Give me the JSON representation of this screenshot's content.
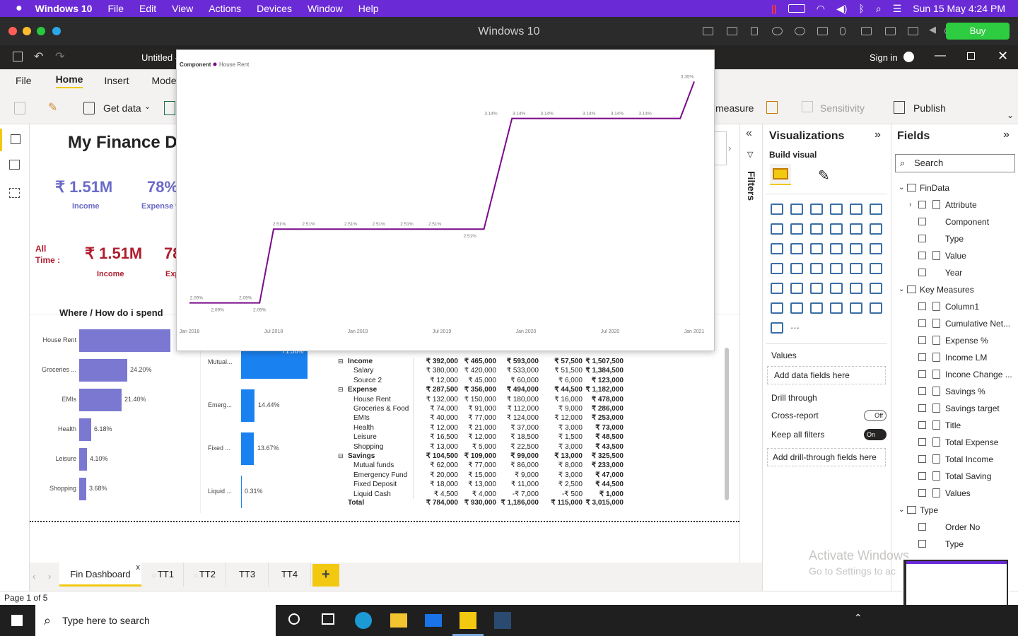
{
  "mac_menu": {
    "app": "Windows 10",
    "items": [
      "File",
      "Edit",
      "View",
      "Actions",
      "Devices",
      "Window",
      "Help"
    ],
    "clock": "Sun 15 May  4:24 PM"
  },
  "vm": {
    "title": "Windows 10",
    "buy": "Buy"
  },
  "pbi": {
    "doc_title": "Untitled -",
    "signin": "Sign in"
  },
  "ribbon": {
    "tabs": [
      "File",
      "Home",
      "Insert",
      "Mode"
    ],
    "get_data": "Get data",
    "measure": "measure",
    "sensitivity": "Sensitivity",
    "publish": "Publish"
  },
  "report": {
    "title": "My Finance D",
    "kpi1_value": "₹ 1.51M",
    "kpi1_label": "Income",
    "kpi2_value": "78%",
    "kpi2_label": "Expense %",
    "all_time": "All\nTime :",
    "kpi3_value": "₹ 1.51M",
    "kpi3_label": "Income",
    "kpi4_value": "78",
    "kpi4_label": "Exp",
    "spend_title": "Where / How do i spend"
  },
  "spend_bars": [
    {
      "label": "House Rent",
      "value": "",
      "pct": 0.46
    },
    {
      "label": "Groceries ...",
      "value": "24.20%",
      "pct": 0.242
    },
    {
      "label": "EMIs",
      "value": "21.40%",
      "pct": 0.214
    },
    {
      "label": "Health",
      "value": "6.18%",
      "pct": 0.0618
    },
    {
      "label": "Leisure",
      "value": "4.10%",
      "pct": 0.041
    },
    {
      "label": "Shopping",
      "value": "3.68%",
      "pct": 0.0368
    }
  ],
  "savings_bars": [
    {
      "label": "Mutual...",
      "value": "71.58%",
      "pct": 0.7158
    },
    {
      "label": "Emerg...",
      "value": "14.44%",
      "pct": 0.1444
    },
    {
      "label": "Fixed ...",
      "value": "13.67%",
      "pct": 0.1367
    },
    {
      "label": "Liquid ...",
      "value": "0.31%",
      "pct": 0.0031
    }
  ],
  "matrix": [
    [
      "Income",
      "₹ 392,000",
      "₹ 465,000",
      "₹ 593,000",
      "₹ 57,500",
      "₹ 1,507,500"
    ],
    [
      "Salary",
      "₹ 380,000",
      "₹ 420,000",
      "₹ 533,000",
      "₹ 51,500",
      "₹ 1,384,500"
    ],
    [
      "Source 2",
      "₹ 12,000",
      "₹ 45,000",
      "₹ 60,000",
      "₹ 6,000",
      "₹ 123,000"
    ],
    [
      "Expense",
      "₹ 287,500",
      "₹ 356,000",
      "₹ 494,000",
      "₹ 44,500",
      "₹ 1,182,000"
    ],
    [
      "House Rent",
      "₹ 132,000",
      "₹ 150,000",
      "₹ 180,000",
      "₹ 16,000",
      "₹ 478,000"
    ],
    [
      "Groceries & Food",
      "₹ 74,000",
      "₹ 91,000",
      "₹ 112,000",
      "₹ 9,000",
      "₹ 286,000"
    ],
    [
      "EMIs",
      "₹ 40,000",
      "₹ 77,000",
      "₹ 124,000",
      "₹ 12,000",
      "₹ 253,000"
    ],
    [
      "Health",
      "₹ 12,000",
      "₹ 21,000",
      "₹ 37,000",
      "₹ 3,000",
      "₹ 73,000"
    ],
    [
      "Leisure",
      "₹ 16,500",
      "₹ 12,000",
      "₹ 18,500",
      "₹ 1,500",
      "₹ 48,500"
    ],
    [
      "Shopping",
      "₹ 13,000",
      "₹ 5,000",
      "₹ 22,500",
      "₹ 3,000",
      "₹ 43,500"
    ],
    [
      "Savings",
      "₹ 104,500",
      "₹ 109,000",
      "₹ 99,000",
      "₹ 13,000",
      "₹ 325,500"
    ],
    [
      "Mutual funds",
      "₹ 62,000",
      "₹ 77,000",
      "₹ 86,000",
      "₹ 8,000",
      "₹ 233,000"
    ],
    [
      "Emergency Fund",
      "₹ 20,000",
      "₹ 15,000",
      "₹ 9,000",
      "₹ 3,000",
      "₹ 47,000"
    ],
    [
      "Fixed Deposit",
      "₹ 18,000",
      "₹ 13,000",
      "₹ 11,000",
      "₹ 2,500",
      "₹ 44,500"
    ],
    [
      "Liquid Cash",
      "₹ 4,500",
      "₹ 4,000",
      "-₹ 7,000",
      "-₹ 500",
      "₹ 1,000"
    ]
  ],
  "matrix_total": [
    "Total",
    "₹ 784,000",
    "₹ 930,000",
    "₹ 1,186,000",
    "₹ 115,000",
    "₹ 3,015,000"
  ],
  "viz_pane": {
    "title": "Visualizations",
    "build": "Build visual",
    "values": "Values",
    "add_data": "Add data fields here",
    "drill": "Drill through",
    "cross": "Cross-report",
    "cross_state": "Off",
    "keep": "Keep all filters",
    "keep_state": "On",
    "add_drill": "Add drill-through fields here"
  },
  "filters_label": "Filters",
  "fields_pane": {
    "title": "Fields",
    "search_placeholder": "Search",
    "items": [
      "FinData",
      "Attribute",
      "Component",
      "Type",
      "Value",
      "Year",
      "Key Measures",
      "Column1",
      "Cumulative Net...",
      "Expense %",
      "Income LM",
      "Incone Change ...",
      "Savings %",
      "Savings target",
      "Title",
      "Total Expense",
      "Total Income",
      "Total Saving",
      "Values",
      "Type",
      "Order No",
      "Type"
    ]
  },
  "watermark": {
    "line1": "Activate Windows",
    "line2": "Go to Settings to ac"
  },
  "page_tabs": [
    "Fin Dashboard",
    "TT1",
    "TT2",
    "TT3",
    "TT4"
  ],
  "status": "Page 1 of 5",
  "taskbar": {
    "search": "Type here to search"
  },
  "chart_data": {
    "type": "line",
    "legend_title": "Component",
    "series": [
      {
        "name": "House Rent",
        "color": "#7a0a8a"
      }
    ],
    "x_ticks": [
      "Jan 2018",
      "Jul 2018",
      "Jan 2019",
      "Jul 2019",
      "Jan 2020",
      "Jul 2020",
      "Jan 2021"
    ],
    "points": [
      [
        "2018-01",
        2.09
      ],
      [
        "2018-02",
        2.09
      ],
      [
        "2018-03",
        2.09
      ],
      [
        "2018-04",
        2.09
      ],
      [
        "2018-05",
        2.09
      ],
      [
        "2018-06",
        2.09
      ],
      [
        "2018-07",
        2.51
      ],
      [
        "2018-08",
        2.51
      ],
      [
        "2018-10",
        2.51
      ],
      [
        "2018-12",
        2.51
      ],
      [
        "2019-02",
        2.51
      ],
      [
        "2019-04",
        2.51
      ],
      [
        "2019-06",
        2.51
      ],
      [
        "2019-08",
        2.51
      ],
      [
        "2019-10",
        2.51
      ],
      [
        "2019-12",
        3.14
      ],
      [
        "2020-02",
        3.14
      ],
      [
        "2020-04",
        3.14
      ],
      [
        "2020-06",
        3.14
      ],
      [
        "2020-08",
        3.14
      ],
      [
        "2020-10",
        3.14
      ],
      [
        "2020-12",
        3.14
      ],
      [
        "2021-01",
        3.35
      ]
    ],
    "labels": [
      "2.09%",
      "2.09%",
      "2.09%",
      "2.09%",
      "2.51%",
      "2.51%",
      "2.51%",
      "2.51%",
      "2.51%",
      "2.51%",
      "2.51%",
      "3.14%",
      "3.14%",
      "3.14%",
      "3.14%",
      "3.14%",
      "3.14%",
      "3.35%"
    ]
  }
}
